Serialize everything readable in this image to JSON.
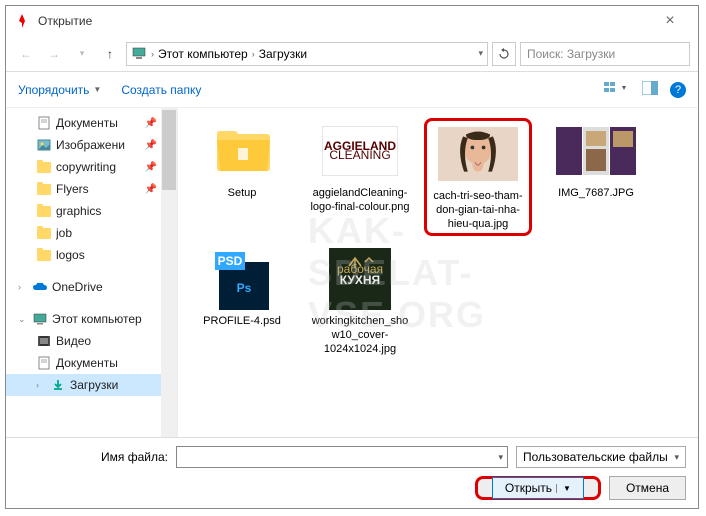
{
  "window": {
    "title": "Открытие"
  },
  "breadcrumb": {
    "location1": "Этот компьютер",
    "location2": "Загрузки"
  },
  "search": {
    "placeholder": "Поиск: Загрузки"
  },
  "toolbar": {
    "organize": "Упорядочить",
    "newFolder": "Создать папку"
  },
  "tree": {
    "docs": "Документы",
    "images": "Изображени",
    "copywriting": "copywriting",
    "flyers": "Flyers",
    "graphics": "graphics",
    "job": "job",
    "logos": "logos",
    "onedrive": "OneDrive",
    "thispc": "Этот компьютер",
    "video": "Видео",
    "documents": "Документы",
    "downloads": "Загрузки"
  },
  "files": [
    {
      "name": "Setup",
      "type": "folder"
    },
    {
      "name": "aggielandCleaning-logo-final-colour.png",
      "type": "image-logo"
    },
    {
      "name": "cach-tri-seo-tham-don-gian-tai-nha-hieu-qua.jpg",
      "type": "image-photo",
      "highlighted": true
    },
    {
      "name": "IMG_7687.JPG",
      "type": "image-brochure"
    },
    {
      "name": "PROFILE-4.psd",
      "type": "psd"
    },
    {
      "name": "workingkitchen_show10_cover-1024x1024.jpg",
      "type": "image-dark"
    }
  ],
  "watermark": "KAK-SDELAT-VSE.ORG",
  "filename": {
    "label": "Имя файла:",
    "value": ""
  },
  "filter": {
    "label": "Пользовательские файлы"
  },
  "buttons": {
    "open": "Открыть",
    "cancel": "Отмена"
  }
}
